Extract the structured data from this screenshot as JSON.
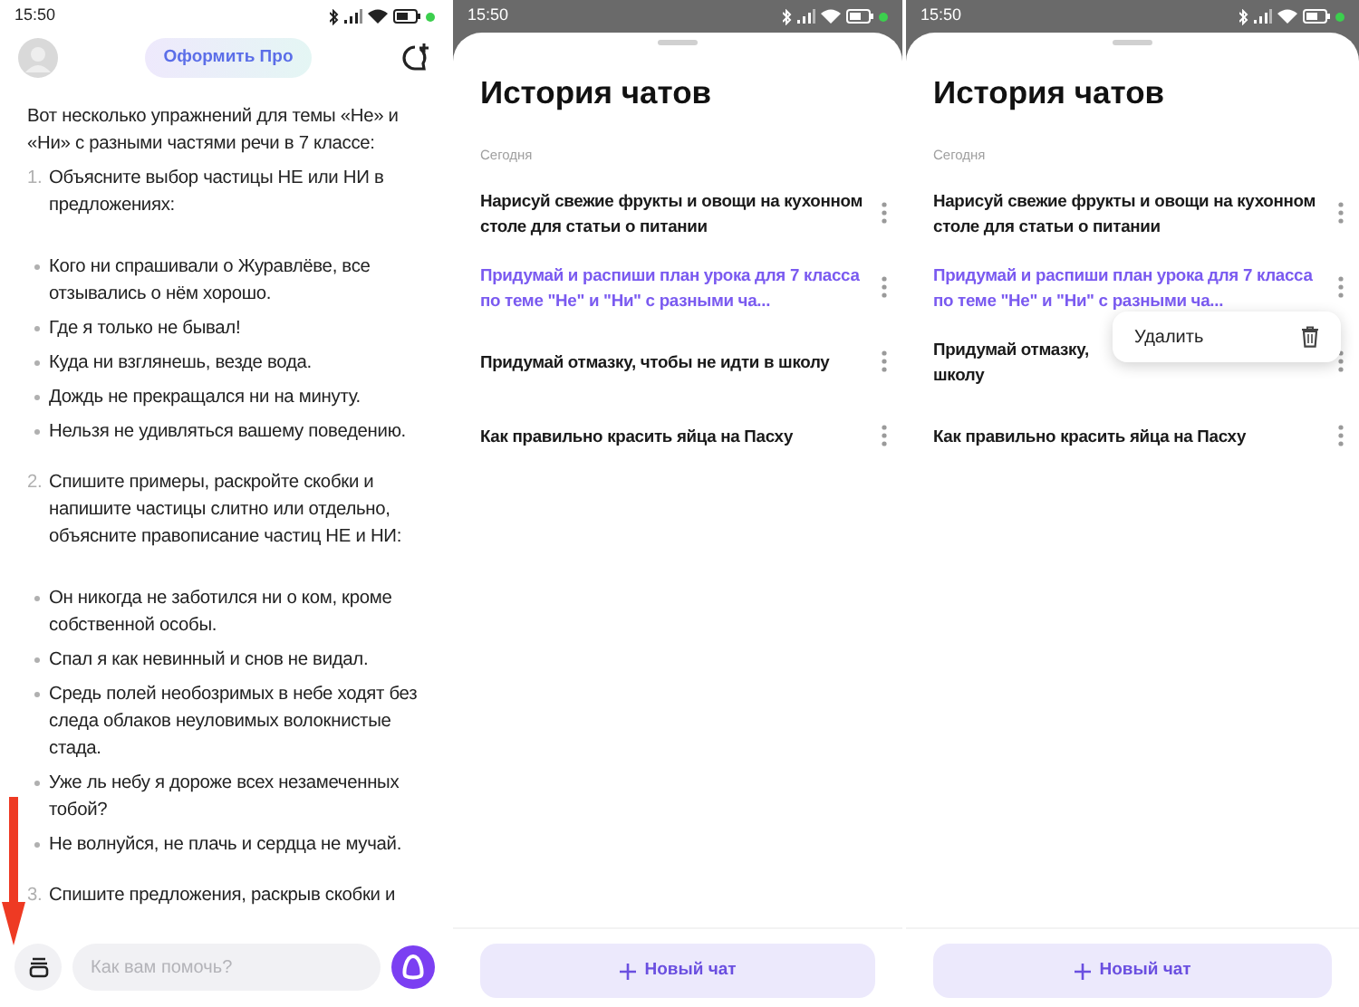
{
  "panels": [
    {
      "kind": "chat",
      "status_bar": {
        "time": "15:50"
      },
      "pro_button": "Оформить Про",
      "intro": "Вот несколько упражнений для темы «Не» и «Ни» с разными частями речи в 7 классе:",
      "blocks": [
        {
          "kind": "numbered",
          "number": "1.",
          "text": "Объясните выбор частицы НЕ или НИ в предложениях:"
        },
        {
          "kind": "bullet",
          "text": "Кого ни спрашивали о Журавлёве, все отзывались о нём хорошо."
        },
        {
          "kind": "bullet",
          "text": "Где я только не бывал!"
        },
        {
          "kind": "bullet",
          "text": "Куда ни взглянешь, везде вода."
        },
        {
          "kind": "bullet",
          "text": "Дождь не прекращался ни на минуту."
        },
        {
          "kind": "bullet",
          "text": "Нельзя не удивляться вашему поведению."
        },
        {
          "kind": "numbered",
          "number": "2.",
          "text": "Спишите примеры, раскройте скобки и напишите частицы слитно или отдельно, объясните правописание частиц НЕ и НИ:"
        },
        {
          "kind": "bullet",
          "text": "Он никогда не заботился ни о ком, кроме собственной особы."
        },
        {
          "kind": "bullet",
          "text": "Спал я как невинный и снов не видал."
        },
        {
          "kind": "bullet",
          "text": "Средь полей необозримых в небе ходят без следа облаков неуловимых волокнистые стада."
        },
        {
          "kind": "bullet",
          "text": "Уже ль небу я дороже всех незамеченных тобой?"
        },
        {
          "kind": "bullet",
          "text": "Не волнуйся, не плачь и сердца не мучай."
        },
        {
          "kind": "numbered",
          "number": "3.",
          "text": "Спишите предложения, раскрыв скобки и"
        }
      ],
      "input": {
        "placeholder": "Как вам помочь?"
      }
    },
    {
      "kind": "history",
      "status_bar": {
        "time": "15:50"
      },
      "title": "История чатов",
      "section": "Сегодня",
      "items": [
        {
          "text": "Нарисуй свежие фрукты и овощи на кухонном столе для статьи о питании",
          "selected": false
        },
        {
          "text": "Придумай и распиши план урока для 7 класса по теме \"Не\" и \"Ни\" с разными ча...",
          "selected": true
        },
        {
          "text": "Придумай отмазку, чтобы не идти в школу",
          "selected": false
        },
        {
          "text": "Как правильно красить яйца на Пасху",
          "selected": false
        }
      ],
      "new_chat_button": "Новый чат"
    },
    {
      "kind": "history",
      "status_bar": {
        "time": "15:50"
      },
      "title": "История чатов",
      "section": "Сегодня",
      "items": [
        {
          "text": "Нарисуй свежие фрукты и овощи на кухонном столе для статьи о питании",
          "selected": false
        },
        {
          "text": "Придумай и распиши план урока для 7 класса по теме \"Не\" и \"Ни\" с разными ча...",
          "selected": true,
          "context_menu": {
            "item": "Удалить"
          }
        },
        {
          "lines": [
            "Придумай отмазку,",
            "школу"
          ],
          "selected": false
        },
        {
          "text": "Как правильно красить яйца на Пасху",
          "selected": false
        }
      ],
      "new_chat_button": "Новый чат"
    }
  ]
}
